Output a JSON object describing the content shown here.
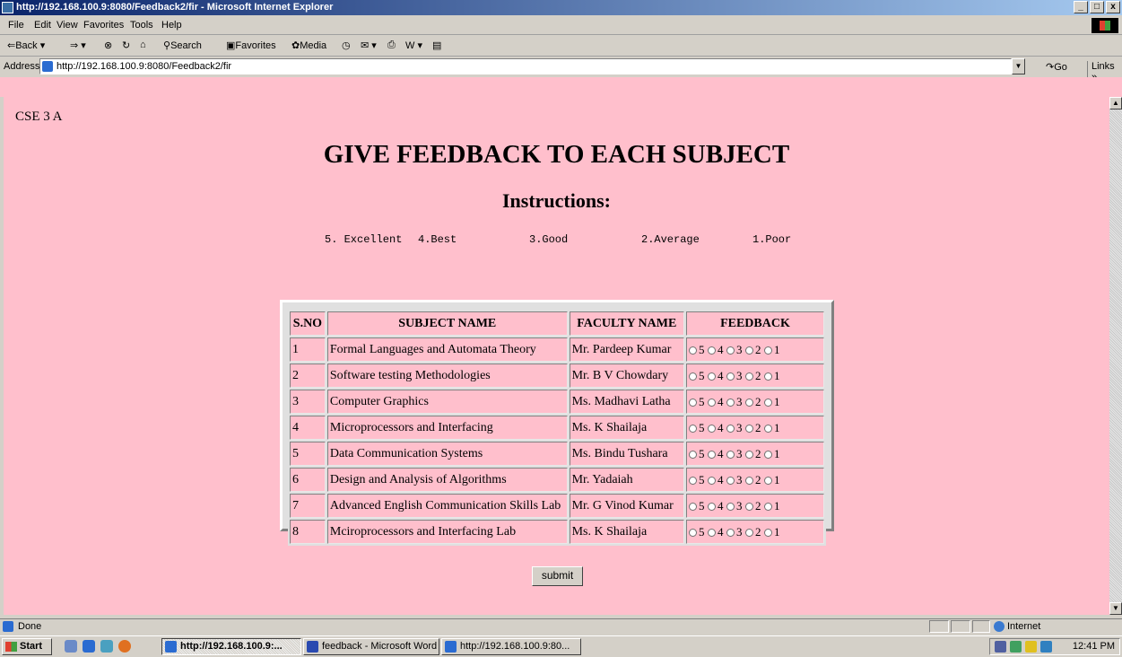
{
  "window": {
    "title": "http://192.168.100.9:8080/Feedback2/fir - Microsoft Internet Explorer",
    "min": "_",
    "max": "5",
    "close": "x"
  },
  "menu": [
    "File",
    "Edit",
    "View",
    "Favorites",
    "Tools",
    "Help"
  ],
  "toolbar": {
    "back": "Back",
    "search": "Search",
    "favorites": "Favorites",
    "media": "Media"
  },
  "address": {
    "label": "Address",
    "url": "http://192.168.100.9:8080/Feedback2/fir",
    "go": "Go",
    "links": "Links »"
  },
  "page": {
    "class_label": "CSE 3 A",
    "heading": "GIVE FEEDBACK TO EACH SUBJECT",
    "subheading": "Instructions:",
    "legend": [
      "5. Excellent",
      "4.Best",
      "3.Good",
      "2.Average",
      "1.Poor"
    ],
    "columns": [
      "S.NO",
      "SUBJECT NAME",
      "FACULTY NAME",
      "FEEDBACK"
    ],
    "rating_options": [
      "5",
      "4",
      "3",
      "2",
      "1"
    ],
    "rows": [
      {
        "sno": "1",
        "subject": "Formal Languages and Automata Theory",
        "faculty": "Mr. Pardeep Kumar"
      },
      {
        "sno": "2",
        "subject": "Software testing Methodologies",
        "faculty": "Mr. B V Chowdary"
      },
      {
        "sno": "3",
        "subject": "Computer Graphics",
        "faculty": "Ms. Madhavi Latha"
      },
      {
        "sno": "4",
        "subject": "Microprocessors and Interfacing",
        "faculty": "Ms. K Shailaja"
      },
      {
        "sno": "5",
        "subject": "Data Communication Systems",
        "faculty": "Ms. Bindu Tushara"
      },
      {
        "sno": "6",
        "subject": "Design and Analysis of Algorithms",
        "faculty": "Mr. Yadaiah"
      },
      {
        "sno": "7",
        "subject": "Advanced English Communication Skills Lab",
        "faculty": "Mr. G Vinod Kumar"
      },
      {
        "sno": "8",
        "subject": "Mciroprocessors and Interfacing Lab",
        "faculty": "Ms. K Shailaja"
      }
    ],
    "submit_label": "submit",
    "background_color": "#ffbfcc"
  },
  "status": {
    "text": "Done",
    "zone": "Internet"
  },
  "taskbar": {
    "start": "Start",
    "tasks": [
      "http://192.168.100.9:...",
      "feedback - Microsoft Word",
      "http://192.168.100.9:80..."
    ],
    "clock": "12:41 PM"
  }
}
